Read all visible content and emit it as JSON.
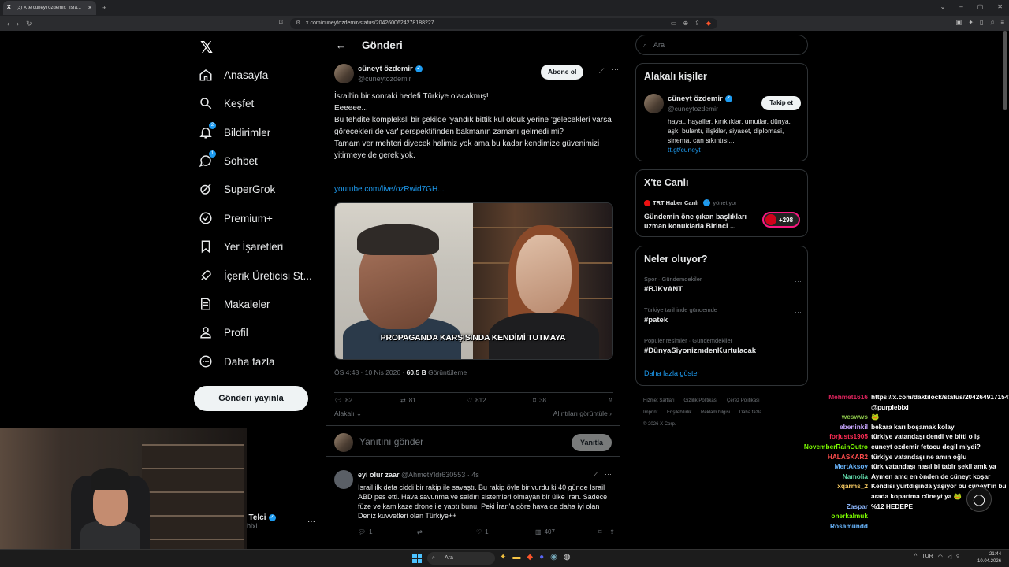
{
  "browser": {
    "tab_title": "(3) X'te cüneyt özdemir: \"İsra...",
    "url": "x.com/cuneytozdemir/status/2042600624278188227"
  },
  "nav": {
    "items": [
      {
        "label": "Anasayfa",
        "icon": "home-icon"
      },
      {
        "label": "Keşfet",
        "icon": "search-icon"
      },
      {
        "label": "Bildirimler",
        "icon": "bell-icon",
        "badge": "2"
      },
      {
        "label": "Sohbet",
        "icon": "chat-icon",
        "badge": "1"
      },
      {
        "label": "SuperGrok",
        "icon": "grok-icon"
      },
      {
        "label": "Premium+",
        "icon": "premium-icon"
      },
      {
        "label": "Yer İşaretleri",
        "icon": "bookmark-icon"
      },
      {
        "label": "İçerik Üreticisi St...",
        "icon": "rocket-icon"
      },
      {
        "label": "Makaleler",
        "icon": "article-icon"
      },
      {
        "label": "Profil",
        "icon": "profile-icon"
      },
      {
        "label": "Daha fazla",
        "icon": "more-icon"
      }
    ],
    "post_button": "Gönderi yayınla",
    "account_name": "ır Telci",
    "account_handle": "lebixi"
  },
  "main": {
    "header_title": "Gönderi",
    "author_name": "cüneyt özdemir",
    "author_handle": "@cuneytozdemir",
    "subscribe_button": "Abone ol",
    "tweet_lines": [
      "İsrail'in bir sonraki hedefi Türkiye olacakmış!",
      "Eeeeee...",
      "Bu tehdite kompleksli bir şekilde 'yandık bittik kül olduk yerine 'gelecekleri varsa görecekleri de var' perspektifinden bakmanın zamanı gelmedi mi?",
      "Tamam ver mehteri diyecek halimiz yok ama bu kadar kendimize güvenimizi yitirmeye de gerek yok."
    ],
    "tweet_link": "youtube.com/live/ozRwid7GH...",
    "video_caption": "PROPAGANDA KARŞISINDA KENDİMİ TUTMAYA",
    "time_date": "ÖS 4:48 · 10 Nis 2026 · ",
    "views": "60,5 B",
    "views_label": " Görüntüleme",
    "stats": {
      "replies": "82",
      "reposts": "81",
      "likes": "812",
      "bookmarks": "38"
    },
    "related_filter": "Alakalı",
    "quotes_link": "Alıntıları görüntüle",
    "reply_placeholder": "Yanıtını gönder",
    "reply_button": "Yanıtla",
    "reply_tweet": {
      "name": "eyi olur zaar",
      "handle": "@AhmetYldr630553 · 4s",
      "text": "İsrail ilk defa ciddi bir rakip ile savaştı. Bu rakip öyle bir vurdu ki 40 günde İsrail ABD pes etti. Hava savunma ve saldırı sistemleri olmayan bir ülke İran. Sadece füze ve kamikaze drone ile yaptı bunu. Peki İran'a göre hava da daha iyi olan  Deniz kuvvetleri olan Türkiye++",
      "replies": "1",
      "likes": "1",
      "views": "407"
    }
  },
  "right": {
    "search_placeholder": "Ara",
    "related_title": "Alakalı kişiler",
    "related_name": "cüneyt özdemir",
    "related_handle": "@cuneytozdemir",
    "follow_button": "Takip et",
    "related_bio": "hayat, hayaller, kırıklıklar, umutlar, dünya, aşk, bulantı, ilişkiler, siyaset, diplomasi, sinema, can sıkıntısı...",
    "related_link": "tt.gt/cuneyt",
    "live_title": "X'te Canlı",
    "live_source": "TRT Haber Canlı",
    "live_role": "yönetiyor",
    "live_text": "Gündemin öne çıkan başlıkları uzman konuklarla Birinci ...",
    "live_count": "+298",
    "trends_title": "Neler oluyor?",
    "trends": [
      {
        "context": "Spor · Gündemdekiler",
        "tag": "#BJKvANT"
      },
      {
        "context": "Türkiye tarihinde gündemde",
        "tag": "#patek"
      },
      {
        "context": "Popüler resimler · Gündemdekiler",
        "tag": "#DünyaSiyonizmdenKurtulacak"
      }
    ],
    "show_more": "Daha fazla göster",
    "footer_row1": [
      "Hizmet Şartları",
      "Gizlilik Politikası",
      "Çerez Politikası"
    ],
    "footer_row2": [
      "Imprint",
      "Erişilebilirlik",
      "Reklam bilgisi",
      "Daha fazla ..."
    ],
    "footer_copy": "© 2026 X Corp."
  },
  "chat": [
    {
      "user": "Mehmet1616",
      "color": "#e0245e",
      "msg": "https://x.com/daktilock/status/2042649171543417290 @purplebixi"
    },
    {
      "user": "weswws",
      "color": "#8bc34a",
      "msg": "🐸"
    },
    {
      "user": "ebeninkil",
      "color": "#c9a7ff",
      "msg": "bekara karı boşamak kolay"
    },
    {
      "user": "forjusts1905",
      "color": "#ff2d55",
      "msg": "türkiye vatandaşı dendi ve bitti o iş"
    },
    {
      "user": "NovemberRainOutro",
      "color": "#7cfc00",
      "msg": "cuneyt ozdemir fetocu degil miydi?"
    },
    {
      "user": "HALASKAR2",
      "color": "#ff4d4d",
      "msg": "türkiye vatandaşı ne amın oğlu"
    },
    {
      "user": "MertAksoy",
      "color": "#6ab7ff",
      "msg": "türk vatandaşı nasıl bi tabir şekil amk ya"
    },
    {
      "user": "Namolia",
      "color": "#5fd6a8",
      "msg": "Aymen amq en önden de cüneyt koşar"
    },
    {
      "user": "xqarms_2",
      "color": "#ffd166",
      "msg": "Kendisi yurtdışında yaşıyor bu cüneyt'in bu arada kopartma cüneyt ya 🐸"
    },
    {
      "user": "Zaspar",
      "color": "#8ab4f8",
      "msg": "%12 HEDEPE"
    },
    {
      "user": "onerkalmuk",
      "color": "#7cfc00",
      "msg": ""
    },
    {
      "user": "Rosamundd",
      "color": "#6ab7ff",
      "msg": ""
    }
  ],
  "taskbar": {
    "search": "Ara",
    "lang": "TUR",
    "time": "21:44",
    "date": "10.04.2026"
  },
  "colors": {
    "accent": "#1d9bf0",
    "bg": "#000000",
    "border": "#2f3336",
    "muted": "#71767b"
  }
}
